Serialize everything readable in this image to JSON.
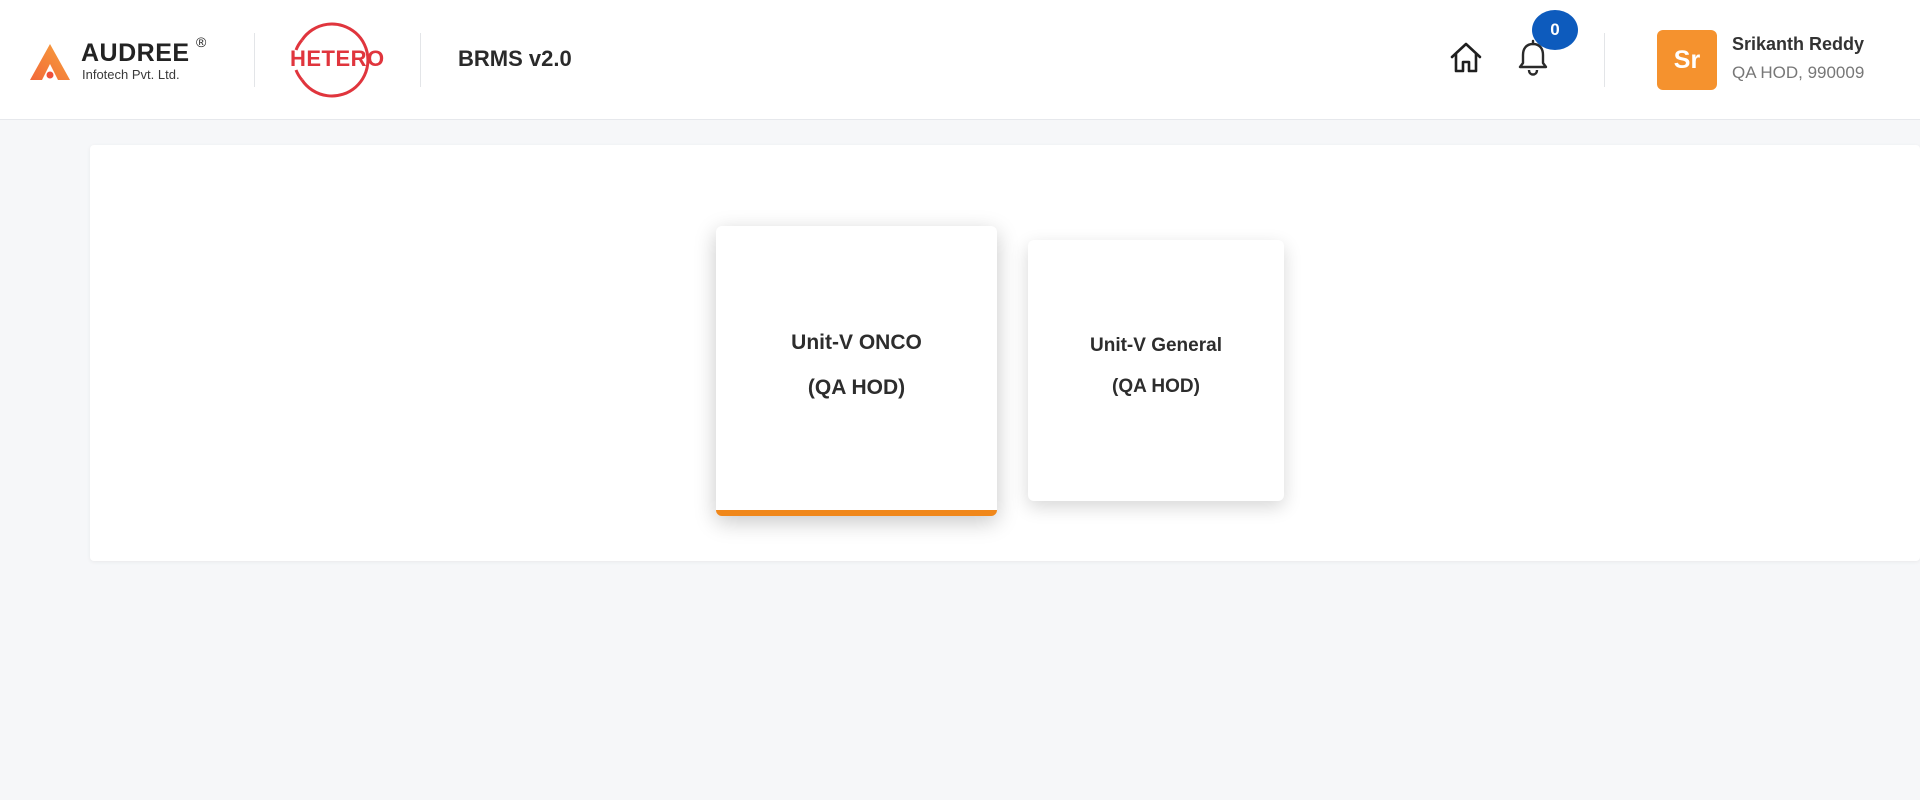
{
  "header": {
    "audree": {
      "name": "AUDREE",
      "registered": "®",
      "subtitle": "Infotech Pvt. Ltd."
    },
    "partner_logo_text": "HETERO",
    "app_title": "BRMS v2.0",
    "icons": {
      "home": "home-icon",
      "notifications": "bell-icon"
    },
    "notification_count": "0",
    "user": {
      "initials": "Sr",
      "name": "Srikanth Reddy",
      "role_line": "QA HOD, 990009"
    }
  },
  "units": [
    {
      "title": "Unit-V ONCO",
      "role": "(QA HOD)",
      "selected": true
    },
    {
      "title": "Unit-V General",
      "role": "(QA HOD)",
      "selected": false
    }
  ],
  "colors": {
    "accent_orange": "#f0871a",
    "avatar_bg": "#f5922e",
    "badge_blue": "#0d5bbd",
    "hetero_red": "#e0353d",
    "page_bg": "#f6f7f9"
  }
}
